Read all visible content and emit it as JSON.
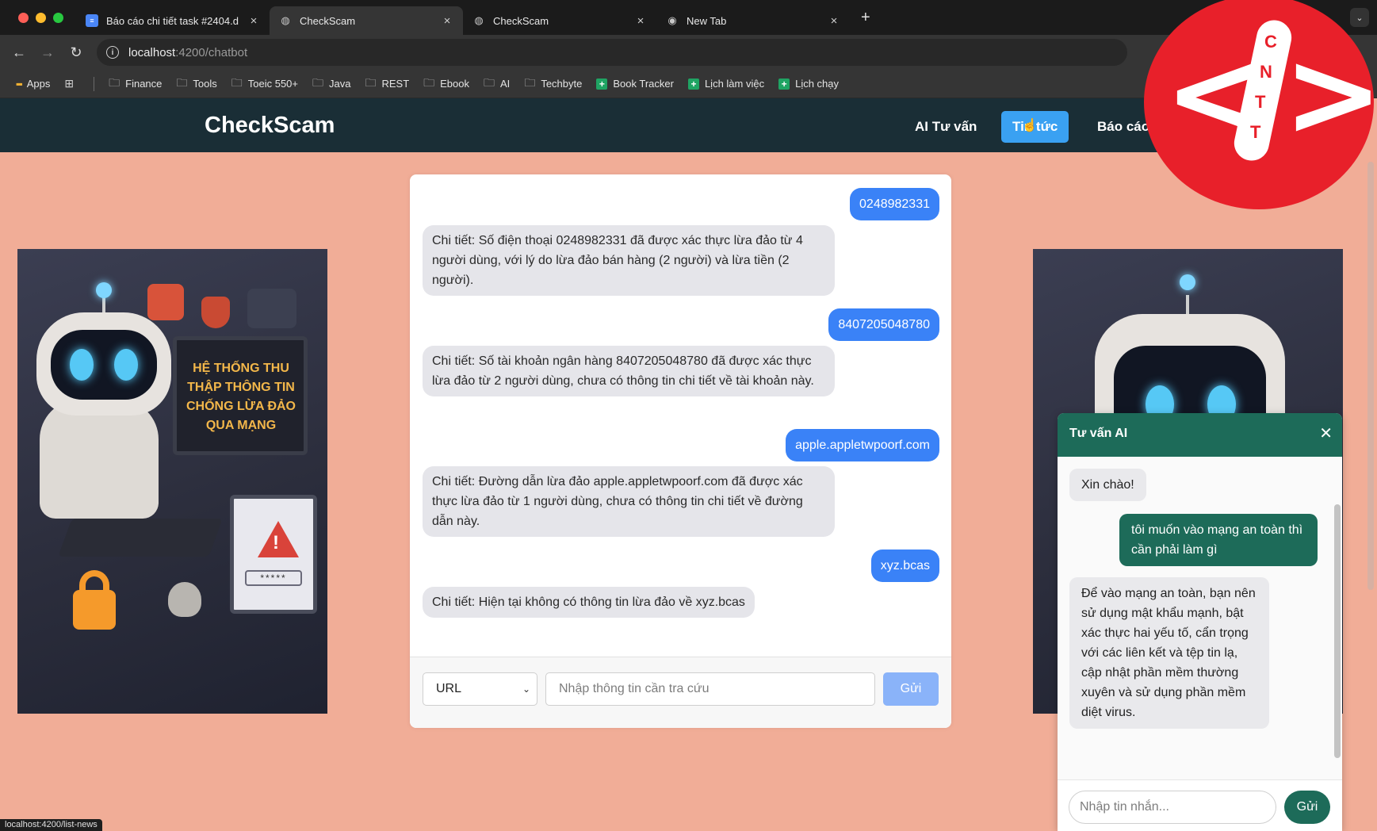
{
  "browser": {
    "tabs": [
      {
        "title": "Báo cáo chi tiết task #2404.d",
        "favicon": "docs-icon",
        "active": false
      },
      {
        "title": "CheckScam",
        "favicon": "globe-icon",
        "active": true
      },
      {
        "title": "CheckScam",
        "favicon": "globe-icon",
        "active": false
      },
      {
        "title": "New Tab",
        "favicon": "chrome-icon",
        "active": false
      }
    ],
    "url_host": "localhost",
    "url_path": ":4200/chatbot",
    "bookmarks": [
      {
        "label": "Apps",
        "icon": "apps-grid-icon"
      },
      {
        "label": "Finance",
        "icon": "folder-icon"
      },
      {
        "label": "Tools",
        "icon": "folder-icon"
      },
      {
        "label": "Toeic 550+",
        "icon": "folder-icon"
      },
      {
        "label": "Java",
        "icon": "folder-icon"
      },
      {
        "label": "REST",
        "icon": "folder-icon"
      },
      {
        "label": "Ebook",
        "icon": "folder-icon"
      },
      {
        "label": "AI",
        "icon": "folder-icon"
      },
      {
        "label": "Techbyte",
        "icon": "folder-icon"
      },
      {
        "label": "Book Tracker",
        "icon": "sheets-icon"
      },
      {
        "label": "Lịch làm việc",
        "icon": "sheets-icon"
      },
      {
        "label": "Lịch chạy",
        "icon": "sheets-icon"
      }
    ],
    "status_url": "localhost:4200/list-news"
  },
  "app": {
    "brand": "CheckScam",
    "nav": {
      "ai_advice": "AI Tư vấn",
      "news": "Tin tức",
      "report": "Báo cáo"
    }
  },
  "images": {
    "left_monitor_text": "HỆ THỐNG THU THẬP THÔNG TIN CHỐNG LỪA ĐẢO QUA MẠNG",
    "left_password": "*****"
  },
  "chat": {
    "messages": [
      {
        "role": "user",
        "text": "0248982331"
      },
      {
        "role": "bot",
        "text": "Chi tiết: Số điện thoại 0248982331 đã được xác thực lừa đảo từ 4 người dùng, với lý do lừa đảo bán hàng (2 người) và lừa tiền (2 người)."
      },
      {
        "role": "user",
        "text": "8407205048780"
      },
      {
        "role": "bot",
        "text": "Chi tiết: Số tài khoản ngân hàng 8407205048780 đã được xác thực lừa đảo từ 2 người dùng, chưa có thông tin chi tiết về tài khoản này."
      },
      {
        "role": "user",
        "text": "apple.appletwpoorf.com"
      },
      {
        "role": "bot",
        "text": "Chi tiết: Đường dẫn lừa đảo apple.appletwpoorf.com đã được xác thực lừa đảo từ 1 người dùng, chưa có thông tin chi tiết về đường dẫn này."
      },
      {
        "role": "user",
        "text": "xyz.bcas"
      },
      {
        "role": "bot",
        "text": "Chi tiết: Hiện tại không có thông tin lừa đảo về xyz.bcas"
      }
    ],
    "type_selected": "URL",
    "input_placeholder": "Nhập thông tin cần tra cứu",
    "send_label": "Gửi"
  },
  "ai_widget": {
    "title": "Tư vấn AI",
    "close_icon": "close-icon",
    "messages": [
      {
        "role": "bot",
        "text": "Xin chào!"
      },
      {
        "role": "user",
        "text": "tôi muốn vào mạng an toàn thì cần phải làm gì"
      },
      {
        "role": "bot",
        "text": "Để vào mạng an toàn, bạn nên sử dụng mật khẩu mạnh, bật xác thực hai yếu tố, cẩn trọng với các liên kết và tệp tin lạ, cập nhật phần mềm thường xuyên và sử dụng phần mềm diệt virus."
      }
    ],
    "input_placeholder": "Nhập tin nhắn...",
    "send_label": "Gửi"
  },
  "logo": {
    "letters": [
      "C",
      "N",
      "T",
      "T"
    ]
  },
  "colors": {
    "header_bg": "#1a2e36",
    "page_bg": "#f1ad97",
    "user_bubble": "#3a82f7",
    "ai_accent": "#1d6b59",
    "active_nav": "#3aa1f2",
    "logo_red": "#e8202a"
  }
}
